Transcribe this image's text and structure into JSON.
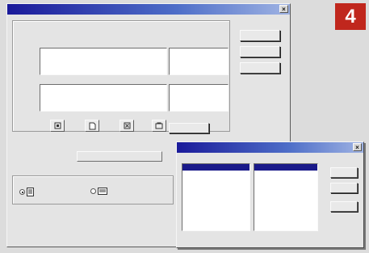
{
  "main_dialog": {
    "title": "",
    "group_label": "",
    "description": "",
    "col_headers": [
      "",
      "",
      ""
    ],
    "row_labels": [
      "",
      ""
    ],
    "tools": [
      {
        "icon": "field-icon",
        "label": ""
      },
      {
        "icon": "document-icon",
        "label": ""
      },
      {
        "icon": "column-icon",
        "label": ""
      },
      {
        "icon": "page-icon",
        "label": ""
      }
    ],
    "side_button": "",
    "name_label": "",
    "name_value": "",
    "buttons": [
      "",
      "",
      ""
    ],
    "orient_group_label": "",
    "orient_options": [
      {
        "label": "",
        "selected": true
      },
      {
        "label": "",
        "selected": false
      }
    ]
  },
  "badge": "4",
  "popup": {
    "title": "",
    "left_label": "",
    "right_label": "",
    "left_items": [
      "",
      "",
      "",
      "",
      "",
      "",
      "",
      "",
      "",
      ""
    ],
    "right_items": [
      "",
      "",
      "",
      "",
      ""
    ],
    "left_selected": 0,
    "right_selected": 0,
    "buttons": [
      "",
      "",
      ""
    ]
  },
  "colors": {
    "title_bar": "#1a1a9a",
    "badge": "#c0271d",
    "selection": "#1a1a8a"
  }
}
